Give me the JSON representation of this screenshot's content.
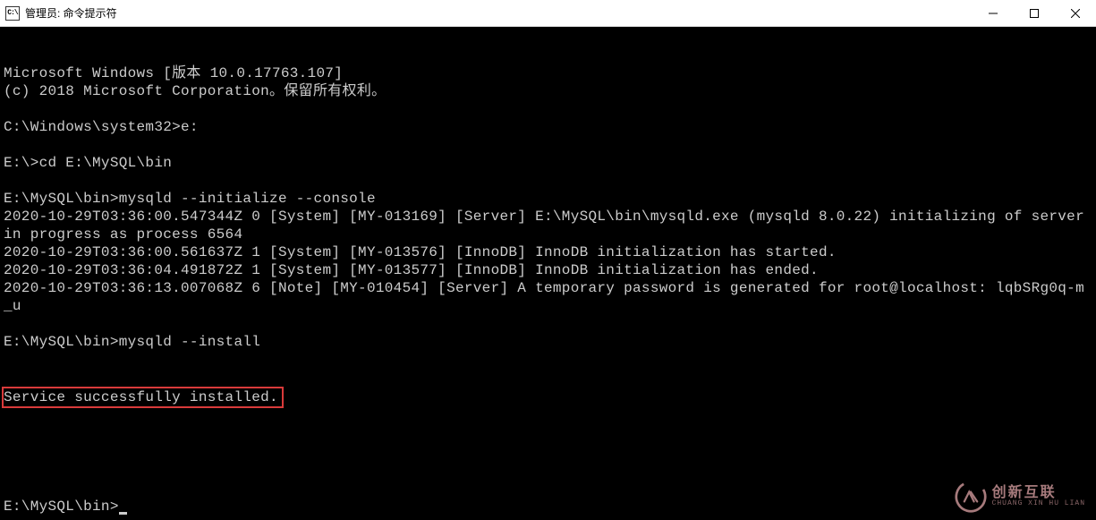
{
  "window": {
    "icon_glyph": "C:\\",
    "title": "管理员: 命令提示符"
  },
  "terminal": {
    "lines": [
      "Microsoft Windows [版本 10.0.17763.107]",
      "(c) 2018 Microsoft Corporation。保留所有权利。",
      "",
      "C:\\Windows\\system32>e:",
      "",
      "E:\\>cd E:\\MySQL\\bin",
      "",
      "E:\\MySQL\\bin>mysqld --initialize --console",
      "2020-10-29T03:36:00.547344Z 0 [System] [MY-013169] [Server] E:\\MySQL\\bin\\mysqld.exe (mysqld 8.0.22) initializing of server in progress as process 6564",
      "2020-10-29T03:36:00.561637Z 1 [System] [MY-013576] [InnoDB] InnoDB initialization has started.",
      "2020-10-29T03:36:04.491872Z 1 [System] [MY-013577] [InnoDB] InnoDB initialization has ended.",
      "2020-10-29T03:36:13.007068Z 6 [Note] [MY-010454] [Server] A temporary password is generated for root@localhost: lqbSRg0q-m_u",
      "",
      "E:\\MySQL\\bin>mysqld --install"
    ],
    "highlighted_line": "Service successfully installed.",
    "prompt_line": "E:\\MySQL\\bin>"
  },
  "watermark": {
    "cn": "创新互联",
    "en": "CHUANG XIN HU LIAN"
  }
}
